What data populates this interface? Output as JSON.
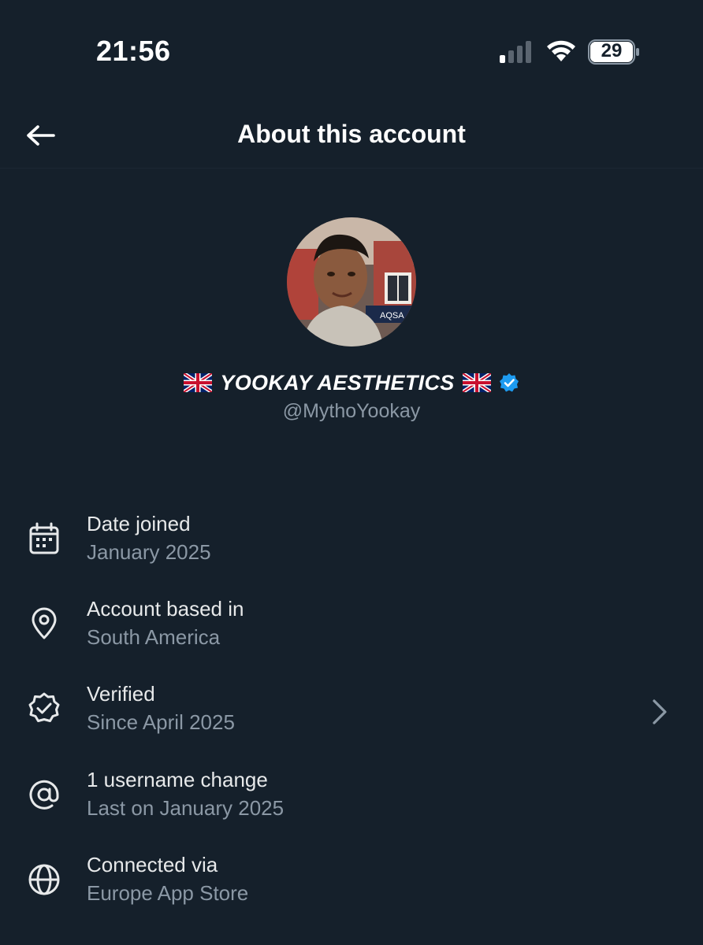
{
  "status_bar": {
    "time": "21:56",
    "battery": "29",
    "icons": [
      "signal-icon",
      "wifi-icon",
      "battery-icon"
    ]
  },
  "header": {
    "title": "About this account",
    "back_icon": "arrow-left-icon"
  },
  "profile": {
    "flag_emoji": "🇬🇧",
    "display_name": "YOOKAY AESTHETICS",
    "handle": "@MythoYookay",
    "verified": true,
    "verified_color": "#1d9bf0"
  },
  "info_items": [
    {
      "icon": "calendar-icon",
      "title": "Date joined",
      "subtitle": "January 2025"
    },
    {
      "icon": "location-pin-icon",
      "title": "Account based in",
      "subtitle": "South America"
    },
    {
      "icon": "verified-badge-icon",
      "title": "Verified",
      "subtitle": "Since April 2025",
      "has_chevron": true
    },
    {
      "icon": "at-sign-icon",
      "title": "1 username change",
      "subtitle": "Last on January 2025"
    },
    {
      "icon": "globe-icon",
      "title": "Connected via",
      "subtitle": "Europe App Store"
    }
  ],
  "colors": {
    "background": "#15202b",
    "primary_text": "#e7e9ea",
    "secondary_text": "#8b98a5",
    "accent": "#1d9bf0"
  }
}
